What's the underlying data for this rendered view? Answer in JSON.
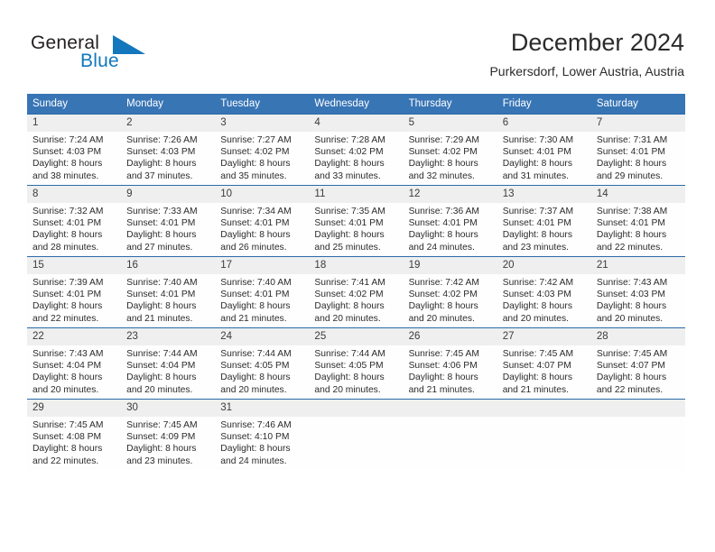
{
  "brand": {
    "word_one": "General",
    "word_two": "Blue",
    "flag_icon": "triangle-flag-icon",
    "color_dark": "#231f20",
    "color_blue": "#1277bc"
  },
  "header": {
    "month_title": "December 2024",
    "location": "Purkersdorf, Lower Austria, Austria"
  },
  "theme": {
    "header_row_bg": "#3875b5",
    "daynum_bg": "#efefef",
    "cell_border": "#2c6aa8",
    "text": "#2b2b2b"
  },
  "calendar": {
    "weekdays": [
      "Sunday",
      "Monday",
      "Tuesday",
      "Wednesday",
      "Thursday",
      "Friday",
      "Saturday"
    ],
    "weeks": [
      [
        {
          "day": "1",
          "sunrise": "Sunrise: 7:24 AM",
          "sunset": "Sunset: 4:03 PM",
          "daylight_1": "Daylight: 8 hours",
          "daylight_2": "and 38 minutes."
        },
        {
          "day": "2",
          "sunrise": "Sunrise: 7:26 AM",
          "sunset": "Sunset: 4:03 PM",
          "daylight_1": "Daylight: 8 hours",
          "daylight_2": "and 37 minutes."
        },
        {
          "day": "3",
          "sunrise": "Sunrise: 7:27 AM",
          "sunset": "Sunset: 4:02 PM",
          "daylight_1": "Daylight: 8 hours",
          "daylight_2": "and 35 minutes."
        },
        {
          "day": "4",
          "sunrise": "Sunrise: 7:28 AM",
          "sunset": "Sunset: 4:02 PM",
          "daylight_1": "Daylight: 8 hours",
          "daylight_2": "and 33 minutes."
        },
        {
          "day": "5",
          "sunrise": "Sunrise: 7:29 AM",
          "sunset": "Sunset: 4:02 PM",
          "daylight_1": "Daylight: 8 hours",
          "daylight_2": "and 32 minutes."
        },
        {
          "day": "6",
          "sunrise": "Sunrise: 7:30 AM",
          "sunset": "Sunset: 4:01 PM",
          "daylight_1": "Daylight: 8 hours",
          "daylight_2": "and 31 minutes."
        },
        {
          "day": "7",
          "sunrise": "Sunrise: 7:31 AM",
          "sunset": "Sunset: 4:01 PM",
          "daylight_1": "Daylight: 8 hours",
          "daylight_2": "and 29 minutes."
        }
      ],
      [
        {
          "day": "8",
          "sunrise": "Sunrise: 7:32 AM",
          "sunset": "Sunset: 4:01 PM",
          "daylight_1": "Daylight: 8 hours",
          "daylight_2": "and 28 minutes."
        },
        {
          "day": "9",
          "sunrise": "Sunrise: 7:33 AM",
          "sunset": "Sunset: 4:01 PM",
          "daylight_1": "Daylight: 8 hours",
          "daylight_2": "and 27 minutes."
        },
        {
          "day": "10",
          "sunrise": "Sunrise: 7:34 AM",
          "sunset": "Sunset: 4:01 PM",
          "daylight_1": "Daylight: 8 hours",
          "daylight_2": "and 26 minutes."
        },
        {
          "day": "11",
          "sunrise": "Sunrise: 7:35 AM",
          "sunset": "Sunset: 4:01 PM",
          "daylight_1": "Daylight: 8 hours",
          "daylight_2": "and 25 minutes."
        },
        {
          "day": "12",
          "sunrise": "Sunrise: 7:36 AM",
          "sunset": "Sunset: 4:01 PM",
          "daylight_1": "Daylight: 8 hours",
          "daylight_2": "and 24 minutes."
        },
        {
          "day": "13",
          "sunrise": "Sunrise: 7:37 AM",
          "sunset": "Sunset: 4:01 PM",
          "daylight_1": "Daylight: 8 hours",
          "daylight_2": "and 23 minutes."
        },
        {
          "day": "14",
          "sunrise": "Sunrise: 7:38 AM",
          "sunset": "Sunset: 4:01 PM",
          "daylight_1": "Daylight: 8 hours",
          "daylight_2": "and 22 minutes."
        }
      ],
      [
        {
          "day": "15",
          "sunrise": "Sunrise: 7:39 AM",
          "sunset": "Sunset: 4:01 PM",
          "daylight_1": "Daylight: 8 hours",
          "daylight_2": "and 22 minutes."
        },
        {
          "day": "16",
          "sunrise": "Sunrise: 7:40 AM",
          "sunset": "Sunset: 4:01 PM",
          "daylight_1": "Daylight: 8 hours",
          "daylight_2": "and 21 minutes."
        },
        {
          "day": "17",
          "sunrise": "Sunrise: 7:40 AM",
          "sunset": "Sunset: 4:01 PM",
          "daylight_1": "Daylight: 8 hours",
          "daylight_2": "and 21 minutes."
        },
        {
          "day": "18",
          "sunrise": "Sunrise: 7:41 AM",
          "sunset": "Sunset: 4:02 PM",
          "daylight_1": "Daylight: 8 hours",
          "daylight_2": "and 20 minutes."
        },
        {
          "day": "19",
          "sunrise": "Sunrise: 7:42 AM",
          "sunset": "Sunset: 4:02 PM",
          "daylight_1": "Daylight: 8 hours",
          "daylight_2": "and 20 minutes."
        },
        {
          "day": "20",
          "sunrise": "Sunrise: 7:42 AM",
          "sunset": "Sunset: 4:03 PM",
          "daylight_1": "Daylight: 8 hours",
          "daylight_2": "and 20 minutes."
        },
        {
          "day": "21",
          "sunrise": "Sunrise: 7:43 AM",
          "sunset": "Sunset: 4:03 PM",
          "daylight_1": "Daylight: 8 hours",
          "daylight_2": "and 20 minutes."
        }
      ],
      [
        {
          "day": "22",
          "sunrise": "Sunrise: 7:43 AM",
          "sunset": "Sunset: 4:04 PM",
          "daylight_1": "Daylight: 8 hours",
          "daylight_2": "and 20 minutes."
        },
        {
          "day": "23",
          "sunrise": "Sunrise: 7:44 AM",
          "sunset": "Sunset: 4:04 PM",
          "daylight_1": "Daylight: 8 hours",
          "daylight_2": "and 20 minutes."
        },
        {
          "day": "24",
          "sunrise": "Sunrise: 7:44 AM",
          "sunset": "Sunset: 4:05 PM",
          "daylight_1": "Daylight: 8 hours",
          "daylight_2": "and 20 minutes."
        },
        {
          "day": "25",
          "sunrise": "Sunrise: 7:44 AM",
          "sunset": "Sunset: 4:05 PM",
          "daylight_1": "Daylight: 8 hours",
          "daylight_2": "and 20 minutes."
        },
        {
          "day": "26",
          "sunrise": "Sunrise: 7:45 AM",
          "sunset": "Sunset: 4:06 PM",
          "daylight_1": "Daylight: 8 hours",
          "daylight_2": "and 21 minutes."
        },
        {
          "day": "27",
          "sunrise": "Sunrise: 7:45 AM",
          "sunset": "Sunset: 4:07 PM",
          "daylight_1": "Daylight: 8 hours",
          "daylight_2": "and 21 minutes."
        },
        {
          "day": "28",
          "sunrise": "Sunrise: 7:45 AM",
          "sunset": "Sunset: 4:07 PM",
          "daylight_1": "Daylight: 8 hours",
          "daylight_2": "and 22 minutes."
        }
      ],
      [
        {
          "day": "29",
          "sunrise": "Sunrise: 7:45 AM",
          "sunset": "Sunset: 4:08 PM",
          "daylight_1": "Daylight: 8 hours",
          "daylight_2": "and 22 minutes."
        },
        {
          "day": "30",
          "sunrise": "Sunrise: 7:45 AM",
          "sunset": "Sunset: 4:09 PM",
          "daylight_1": "Daylight: 8 hours",
          "daylight_2": "and 23 minutes."
        },
        {
          "day": "31",
          "sunrise": "Sunrise: 7:46 AM",
          "sunset": "Sunset: 4:10 PM",
          "daylight_1": "Daylight: 8 hours",
          "daylight_2": "and 24 minutes."
        },
        {
          "day": "",
          "sunrise": "",
          "sunset": "",
          "daylight_1": "",
          "daylight_2": ""
        },
        {
          "day": "",
          "sunrise": "",
          "sunset": "",
          "daylight_1": "",
          "daylight_2": ""
        },
        {
          "day": "",
          "sunrise": "",
          "sunset": "",
          "daylight_1": "",
          "daylight_2": ""
        },
        {
          "day": "",
          "sunrise": "",
          "sunset": "",
          "daylight_1": "",
          "daylight_2": ""
        }
      ]
    ]
  }
}
